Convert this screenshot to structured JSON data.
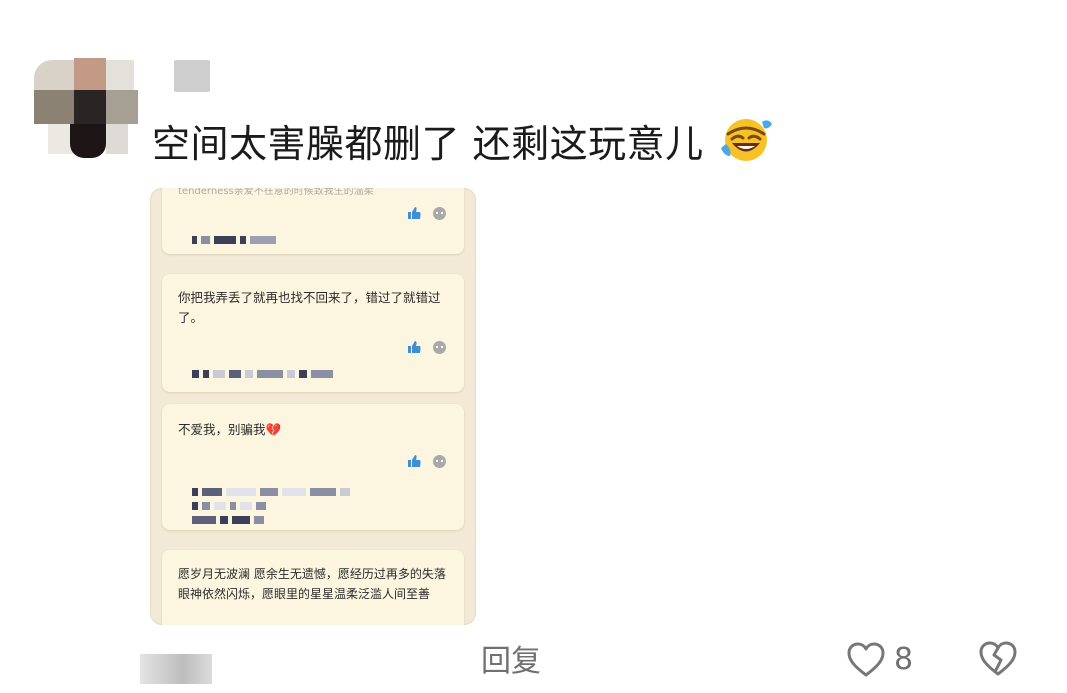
{
  "comment": {
    "text": "空间太害臊都删了 还剩这玩意儿",
    "emoji_icon": "rolling-on-floor-laughing-icon"
  },
  "screenshot": {
    "top_partial_text": "tenderness亲爱不在意的时候致我生的温柔",
    "card2_text": "你把我弄丢了就再也找不回来了，错过了就错过了。",
    "card3_text": "不爱我，别骗我💔",
    "card4_text": "愿岁月无波澜  愿余生无遗憾，愿经历过再多的失落  眼神依然闪烁，愿眼里的星星温柔泛滥人间至善",
    "accent_like_color": "#3e8fd6"
  },
  "footer": {
    "reply_label": "回复",
    "like_count": "8"
  },
  "colors": {
    "text": "#1b1b1b",
    "muted": "#707070",
    "card_bg": "#fcf5df"
  }
}
